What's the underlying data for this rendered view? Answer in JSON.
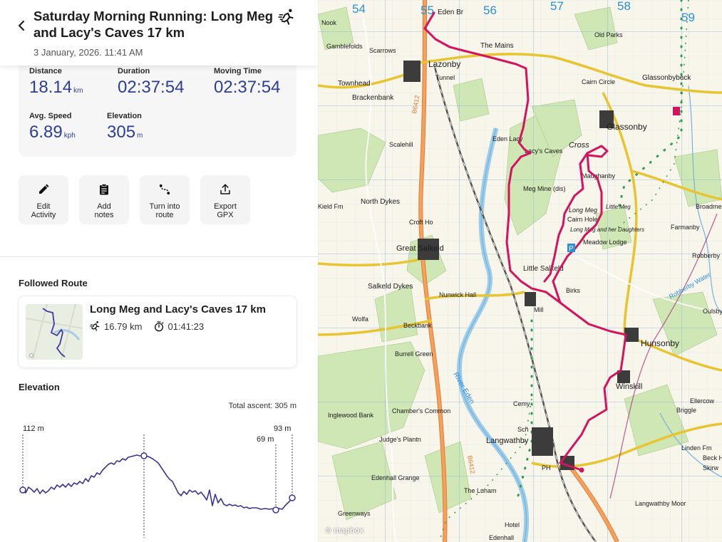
{
  "header": {
    "title": "Saturday Morning Running: Long Meg and Lacy's Caves 17 km",
    "date": "3 January, 2026. 11:41 AM"
  },
  "stats": [
    {
      "label": "Distance",
      "value": "18.14",
      "unit": "km"
    },
    {
      "label": "Duration",
      "value": "02:37:54",
      "unit": ""
    },
    {
      "label": "Moving Time",
      "value": "02:37:54",
      "unit": ""
    },
    {
      "label": "Avg. Speed",
      "value": "6.89",
      "unit": "kph"
    },
    {
      "label": "Elevation",
      "value": "305",
      "unit": "m"
    }
  ],
  "actions": [
    {
      "label_line1": "Edit",
      "label_line2": "Activity",
      "icon": "pencil-icon"
    },
    {
      "label_line1": "Add",
      "label_line2": "notes",
      "icon": "clipboard-icon"
    },
    {
      "label_line1": "Turn into",
      "label_line2": "route",
      "icon": "route-icon"
    },
    {
      "label_line1": "Export",
      "label_line2": "GPX",
      "icon": "upload-icon"
    }
  ],
  "followed_route": {
    "section_title": "Followed Route",
    "name": "Long Meg and Lacy's Caves 17 km",
    "distance": "16.79 km",
    "duration": "01:41:23"
  },
  "elevation": {
    "section_title": "Elevation",
    "total_ascent": "Total ascent: 305 m",
    "marker_labels": [
      "112 m",
      "69 m",
      "93 m"
    ]
  },
  "map": {
    "grid_numbers": [
      "55",
      "56",
      "57",
      "58",
      "59",
      "54"
    ],
    "place_labels": [
      "Eden Br",
      "Lazonby",
      "The Mains",
      "Gamblefolds",
      "Scarrows",
      "Tunnel",
      "Townhead",
      "Brackenbank",
      "Scalehill",
      "Eden Lacy",
      "Lacy's Caves",
      "Cross",
      "Glassonby",
      "Old Parks",
      "Glassonbybeck",
      "Cairn Circle",
      "Meg Mine (dis)",
      "Little Meg",
      "Long Meg",
      "Cairn Hole",
      "Long Meg and her Daughters",
      "Maughanby",
      "Farmanby",
      "Broadmea",
      "Robberby Fm",
      "Meadow Lodge",
      "Little Salkeld",
      "Birks",
      "North Dykes",
      "Croft Ho",
      "Great Salkeld",
      "Salkeld Dykes",
      "Nunwick Hall",
      "Mill",
      "Hunsonby",
      "Winskill",
      "Briggle",
      "Ellercow",
      "Wolfa",
      "Beckbank",
      "Burrell Green",
      "Inglewood Bank",
      "Chamber's Common",
      "Judge's Plantn",
      "Langwathby",
      "Edenhall Grange",
      "The Luham",
      "Greenways",
      "Edenhall",
      "Hotel",
      "Langwathby Moor",
      "Linden Fm",
      "Beck Ho",
      "Skirw",
      "River Eden",
      "Kield Fm",
      "Robberby Water",
      "Oulsby",
      "Nook",
      "Cemy",
      "Sch",
      "PH"
    ],
    "road_labels": [
      "B6412",
      "B6412"
    ],
    "attribution": "mapbox"
  },
  "colors": {
    "accent": "#2c3e96",
    "route": "#d4135f",
    "elevation_line": "#3a3596"
  }
}
